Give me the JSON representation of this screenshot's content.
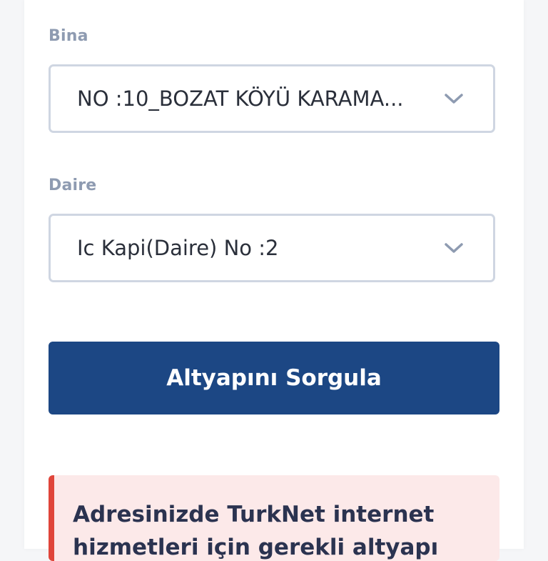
{
  "form": {
    "building": {
      "label": "Bina",
      "value": "NO :10_BOZAT KÖYÜ KARAMA..."
    },
    "apartment": {
      "label": "Daire",
      "value": "Ic Kapi(Daire) No :2"
    },
    "submit_label": "Altyapını Sorgula"
  },
  "alert": {
    "text": "Adresinizde TurkNet internet hizmetleri için gerekli altyapı"
  },
  "colors": {
    "button": "#1c4784",
    "alert_bar": "#e0453a",
    "alert_bg": "#fce9e9",
    "label": "#8e9bb1"
  },
  "icons": {
    "dropdown": "chevron-down-icon"
  }
}
